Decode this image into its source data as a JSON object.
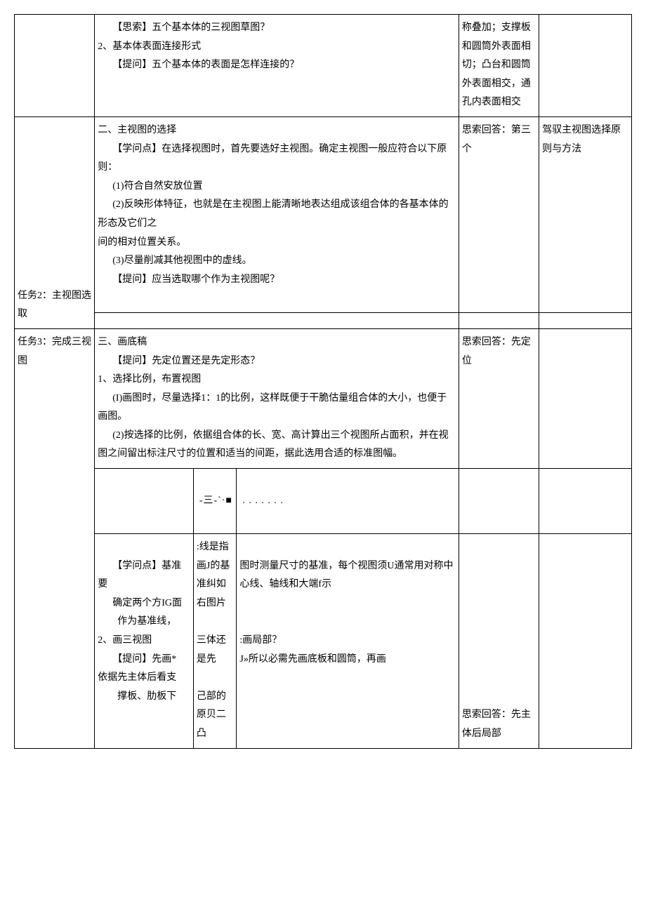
{
  "row1": {
    "content_l1": "【思索】五个基本体的三视图草图？",
    "content_l2": "2、基本体表面连接形式",
    "content_l3": "【提问】五个基本体的表面是怎样连接的？",
    "right": "称叠加；支撑板和圆筒外表面相切；凸台和圆筒外表面相交，通孔内表面相交"
  },
  "row2": {
    "task": "任务2：主视图选取",
    "heading": "二、主视图的选择",
    "l1": "【学问点】在选择视图时，首先要选好主视图。确定主视图一般应符合以下原则：",
    "l2": "(1)符合自然安放位置",
    "l3": "(2)反映形体特征，也就是在主视图上能清晰地表达组成该组合体的各基本体的形态及它们之",
    "l4": "间的相对位置关系。",
    "l5": "(3)尽量削减其他视图中的虚线。",
    "l6": "【提问】应当选取哪个作为主视图呢？",
    "right5": "思索回答：第三个",
    "right6": "驾驭主视图选择原则与方法"
  },
  "row3": {
    "task": "任务3：完成三视图",
    "heading": "三、画底稿",
    "l1": "【提问】先定位置还是先定形态？",
    "l2": "1、选择比例，布置视图",
    "l3": "(I)画图时，尽量选择1：1的比例，这样既便于干脆估量组合体的大小，也便于画图。",
    "l4": "(2)按选择的比例，依据组合体的长、宽、高计算出三个视图所占面积，并在视图之间留出标注尺寸的位置和适当的间距，据此选用合适的标准图幅。",
    "right": "思索回答：先定位"
  },
  "row4": {
    "diagram_left": "-三-`·■",
    "diagram_right": ". . . . . . ."
  },
  "row5": {
    "col2_l1": "【学问点】基准要",
    "col2_l2": "确定两个方IG面",
    "col2_l3": "作为基准线，",
    "col2_l4": "2、画三视图",
    "col2_l5": "【提问】先画*",
    "col2_l6": "依据先主体后看支",
    "col2_l7": "撑板、肋板下",
    "col3_l1": ":线是指画J的基准纠如右图片",
    "col3_l2": "三体还是先",
    "col3_l3": "己部的原贝二凸",
    "col4_l1": "图时测量尺寸的基准，每个视图须U通常用对称中心线、轴线和大端f示",
    "col4_l2": ":画局部？",
    "col4_l3": "J»所以必需先画底板和圆筒，再画",
    "right": "思索回答：先主体后局部"
  }
}
